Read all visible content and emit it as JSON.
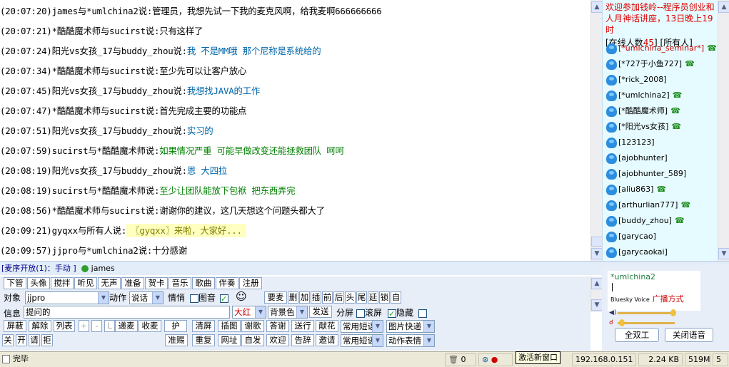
{
  "chat": {
    "messages": [
      {
        "time": "(20:07:20)",
        "users": "james与*umlchina2说:",
        "text": "管理员，我想先试一下我的麦克风啊，给我麦啊666666666",
        "color": "black"
      },
      {
        "time": "(20:07:21)",
        "users": "*酷酷魔术师与sucirst说:",
        "text": "只有这样了",
        "color": "black"
      },
      {
        "time": "(20:07:24)",
        "users": "阳光vs女孩_17与buddy_zhou说:",
        "text": "我 不是MM哦 那个尼称是系统给的",
        "color": "teal"
      },
      {
        "time": "(20:07:34)",
        "users": "*酷酷魔术师与sucirst说:",
        "text": "至少先可以让客户放心",
        "color": "black"
      },
      {
        "time": "(20:07:45)",
        "users": "阳光vs女孩_17与buddy_zhou说:",
        "text": "我想找JAVA的工作",
        "color": "teal"
      },
      {
        "time": "(20:07:47)",
        "users": "*酷酷魔术师与sucirst说:",
        "text": "首先完成主要的功能点",
        "color": "black"
      },
      {
        "time": "(20:07:51)",
        "users": "阳光vs女孩_17与buddy_zhou说:",
        "text": "实习的",
        "color": "teal"
      },
      {
        "time": "(20:07:59)",
        "users": "sucirst与*酷酷魔术师说:",
        "text": "如果情况严重 可能早做改变还能拯救团队 呵呵",
        "color": "green"
      },
      {
        "time": "(20:08:19)",
        "users": "阳光vs女孩_17与buddy_zhou说:",
        "text": "恩 大四拉",
        "color": "teal"
      },
      {
        "time": "(20:08:19)",
        "users": "sucirst与*酷酷魔术师说:",
        "text": "至少让团队能放下包袱 把东西弄完",
        "color": "green"
      },
      {
        "time": "(20:08:56)",
        "users": "*酷酷魔术师与sucirst说:",
        "text": "谢谢你的建议，这几天想这个问题头都大了",
        "color": "black"
      },
      {
        "time": "(20:09:21)",
        "users": "gyqxx与所有人说:",
        "text": "〖gyqxx〗来啦，大家好...",
        "color": "highlight"
      },
      {
        "time": "(20:09:57)",
        "users": "jjpro与*umlchina2说:",
        "text": "十分感谢",
        "color": "black"
      }
    ]
  },
  "sidebar": {
    "welcome": "欢迎参加钱岭--程序员创业和人月神话讲座，13日晚上19时",
    "online_prefix": "[在线人数",
    "online_count": "45",
    "online_suffix": "]",
    "all_users": "[所有人]",
    "users": [
      {
        "name": "[*umlchina_seminar*]",
        "selected": true,
        "phone": true
      },
      {
        "name": "[*727于小鱼727]",
        "selected": false,
        "phone": true
      },
      {
        "name": "[*rick_2008]",
        "selected": false,
        "phone": false
      },
      {
        "name": "[*umlchina2]",
        "selected": false,
        "phone": true
      },
      {
        "name": "[*酷酷魔术师]",
        "selected": false,
        "phone": true
      },
      {
        "name": "[*阳光vs女孩]",
        "selected": false,
        "phone": true
      },
      {
        "name": "[123123]",
        "selected": false,
        "phone": false
      },
      {
        "name": "[ajobhunter]",
        "selected": false,
        "phone": false
      },
      {
        "name": "[ajobhunter_589]",
        "selected": false,
        "phone": false
      },
      {
        "name": "[aliu863]",
        "selected": false,
        "phone": true
      },
      {
        "name": "[arthurlian777]",
        "selected": false,
        "phone": true
      },
      {
        "name": "[buddy_zhou]",
        "selected": false,
        "phone": true
      },
      {
        "name": "[garycao]",
        "selected": false,
        "phone": false
      },
      {
        "name": "[garycaokai]",
        "selected": false,
        "phone": false
      }
    ]
  },
  "statusline": {
    "mic_status": "[麦序开放(1)：手动 ]",
    "mic_user": "james"
  },
  "toolbar": {
    "row1": [
      "下管",
      "头像",
      "搅拌",
      "听见",
      "无声",
      "准备",
      "贺卡",
      "音乐",
      "歌曲",
      "伴奏",
      "注册"
    ],
    "target_label": "对象",
    "target_value": "jjpro",
    "action_label": "动作",
    "action_value": "说话",
    "emotion_label": "情悄",
    "image_label": "图音",
    "row2_btns": [
      "要麦",
      "删",
      "加",
      "插",
      "前",
      "后",
      "头",
      "尾",
      "延",
      "锁",
      "自"
    ],
    "info_label": "信息",
    "info_value": "提问的",
    "font_color": "大红",
    "bg_color": "背景色",
    "send": "发送",
    "split_label": "分屏",
    "scroll_label": "滚屏",
    "hide_label": "隐藏",
    "row3": [
      "屏蔽",
      "解除",
      "列表",
      "+",
      "-",
      "L",
      "递麦",
      "收麦",
      "护",
      "清屏",
      "插图",
      "谢歌",
      "答谢",
      "送行",
      "献花"
    ],
    "row3_combo1": "常用短语",
    "row3_combo2": "图片快递",
    "row4": [
      "关",
      "开",
      "请",
      "拒",
      "准赐",
      "重复",
      "网址",
      "自发",
      "欢迎",
      "告辞",
      "邀请"
    ],
    "row4_combo1": "常用短语",
    "row4_combo2": "动作表情"
  },
  "voice": {
    "user": "*umlchina2",
    "brand": "Bluesky Voice",
    "mode": "广播方式",
    "full_duplex": "全双工",
    "close_voice": "关闭语音"
  },
  "statusbar": {
    "done": "完毕",
    "count": "0",
    "tooltip": "激活新窗口",
    "ip": "192.168.0.151",
    "speed": "2.24 KB",
    "mem": "519M",
    "num": "5"
  }
}
